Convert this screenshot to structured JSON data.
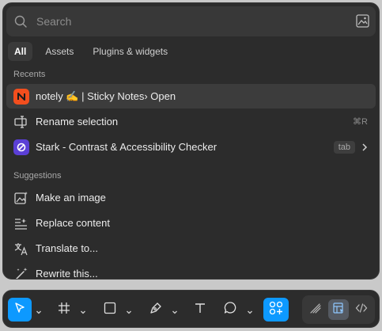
{
  "search": {
    "placeholder": "Search"
  },
  "tabs": [
    {
      "label": "All",
      "active": true
    },
    {
      "label": "Assets",
      "active": false
    },
    {
      "label": "Plugins & widgets",
      "active": false
    }
  ],
  "recents": {
    "heading": "Recents",
    "items": [
      {
        "label": "notely ✍️ | Sticky Notes› Open",
        "icon": "notely-app-icon",
        "highlighted": true
      },
      {
        "label": "Rename selection",
        "icon": "rename-icon",
        "shortcut": "⌘R"
      },
      {
        "label": "Stark - Contrast & Accessibility Checker",
        "icon": "stark-app-icon",
        "badge": "tab"
      }
    ]
  },
  "suggestions": {
    "heading": "Suggestions",
    "items": [
      {
        "label": "Make an image",
        "icon": "image-sparkle-icon"
      },
      {
        "label": "Replace content",
        "icon": "replace-content-icon"
      },
      {
        "label": "Translate to...",
        "icon": "translate-icon"
      },
      {
        "label": "Rewrite this...",
        "icon": "rewrite-sparkle-icon"
      }
    ]
  },
  "toolbar": {
    "tools": [
      "move-tool",
      "frame-tool",
      "shape-tool",
      "pen-tool",
      "text-tool",
      "comment-tool",
      "actions-tool"
    ],
    "modes": [
      "draw-mode",
      "design-mode",
      "dev-mode"
    ]
  },
  "colors": {
    "accent": "#0d99ff",
    "notely": "#f24e1e",
    "stark": "#5b3fd6"
  }
}
